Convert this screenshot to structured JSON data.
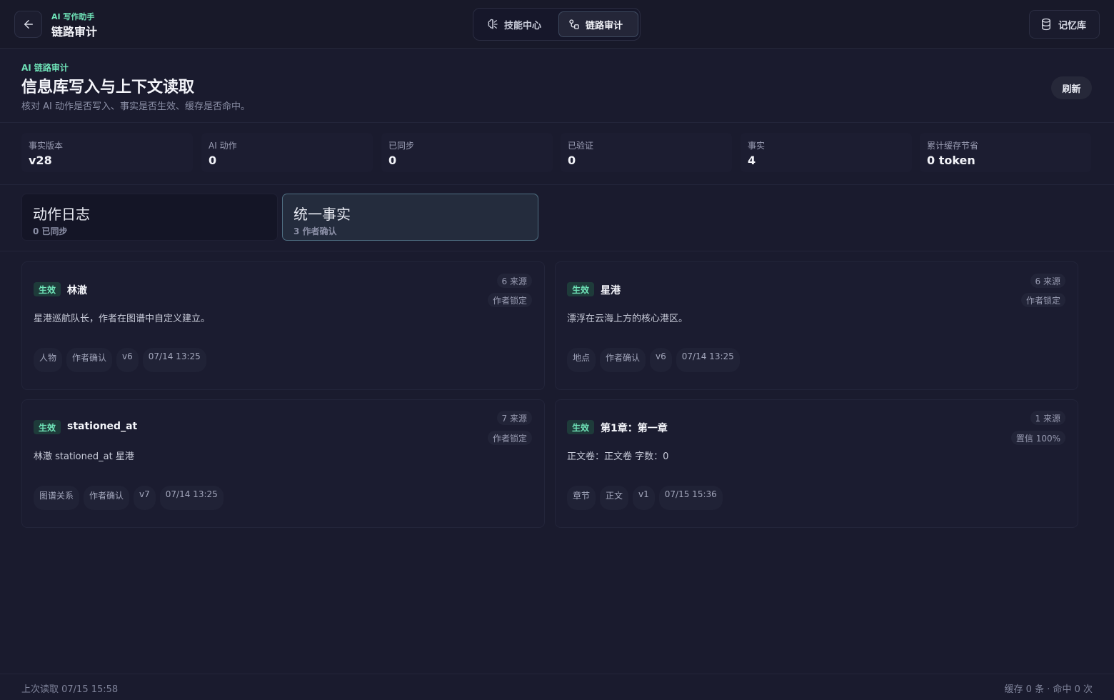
{
  "header": {
    "app_name": "AI 写作助手",
    "page_name": "链路审计",
    "nav": {
      "skills": "技能中心",
      "audit": "链路审计"
    },
    "memory": "记忆库"
  },
  "section": {
    "kicker": "AI 链路审计",
    "title": "信息库写入与上下文读取",
    "desc": "核对 AI 动作是否写入、事实是否生效、缓存是否命中。",
    "refresh": "刷新"
  },
  "stats": [
    {
      "label": "事实版本",
      "value": "v28"
    },
    {
      "label": "AI 动作",
      "value": "0"
    },
    {
      "label": "已同步",
      "value": "0"
    },
    {
      "label": "已验证",
      "value": "0"
    },
    {
      "label": "事实",
      "value": "4"
    },
    {
      "label": "累计缓存节省",
      "value": "0 token"
    }
  ],
  "tabs": [
    {
      "title": "动作日志",
      "sub": "0 已同步"
    },
    {
      "title": "统一事实",
      "sub": "3 作者确认"
    }
  ],
  "cards": [
    {
      "status": "生效",
      "title": "林澈",
      "desc": "星港巡航队长，作者在图谱中自定义建立。",
      "sources": "6 来源",
      "lock": "作者锁定",
      "tags": [
        "人物",
        "作者确认",
        "v6",
        "07/14 13:25"
      ]
    },
    {
      "status": "生效",
      "title": "星港",
      "desc": "漂浮在云海上方的核心港区。",
      "sources": "6 来源",
      "lock": "作者锁定",
      "tags": [
        "地点",
        "作者确认",
        "v6",
        "07/14 13:25"
      ]
    },
    {
      "status": "生效",
      "title": "stationed_at",
      "desc": "林澈 stationed_at 星港",
      "sources": "7 来源",
      "lock": "作者锁定",
      "tags": [
        "图谱关系",
        "作者确认",
        "v7",
        "07/14 13:25"
      ]
    },
    {
      "status": "生效",
      "title": "第1章：第一章",
      "desc": "正文卷：正文卷 字数：0",
      "sources": "1 来源",
      "lock": "置信 100%",
      "tags": [
        "章节",
        "正文",
        "v1",
        "07/15 15:36"
      ]
    }
  ],
  "footer": {
    "last_read": "上次读取 07/15 15:58",
    "cache": "缓存 0 条 · 命中 0 次"
  },
  "colors": {
    "accent": "#6fe3b8",
    "background": "#1a1b2e"
  }
}
